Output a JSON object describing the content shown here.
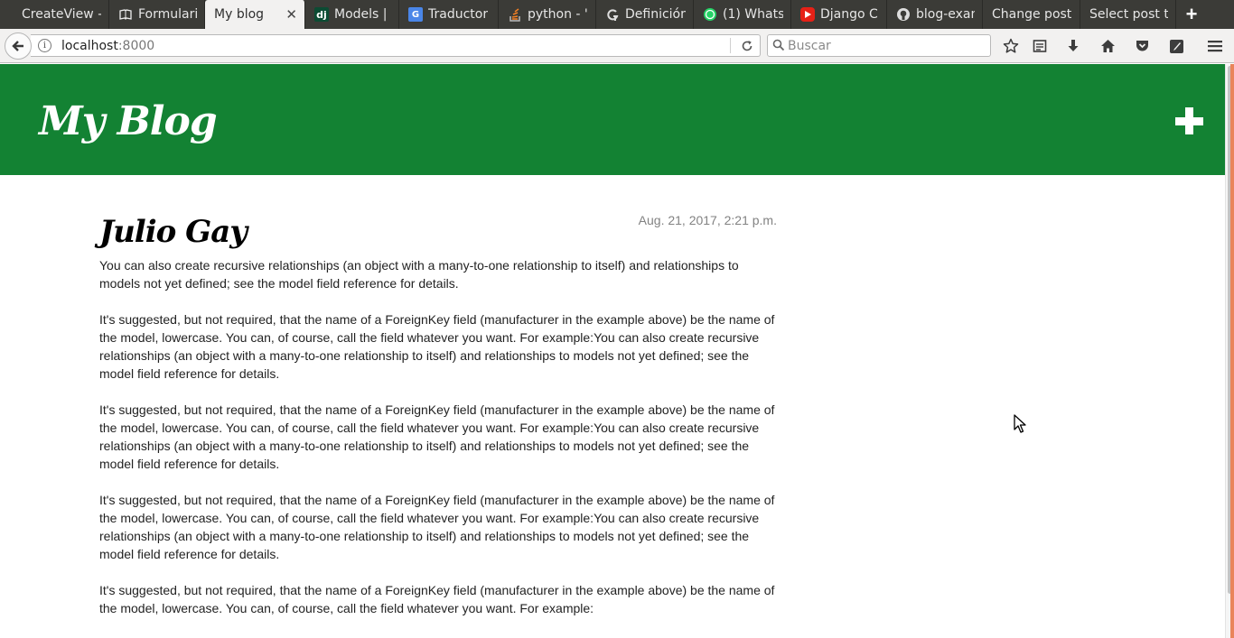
{
  "browser": {
    "tabs": [
      {
        "label": "CreateView -",
        "icon": "none",
        "active": false
      },
      {
        "label": "Formulari",
        "icon": "book-icon",
        "active": false
      },
      {
        "label": "My blog",
        "icon": "none",
        "active": true
      },
      {
        "label": "Models | D",
        "icon": "django-icon",
        "active": false
      },
      {
        "label": "Traductor",
        "icon": "google-translate-icon",
        "active": false
      },
      {
        "label": "python - '",
        "icon": "stackoverflow-icon",
        "active": false
      },
      {
        "label": "Definición",
        "icon": "github-gist-icon",
        "active": false
      },
      {
        "label": "(1) Whats",
        "icon": "whatsapp-icon",
        "active": false
      },
      {
        "label": "Django Cl",
        "icon": "youtube-icon",
        "active": false
      },
      {
        "label": "blog-exam",
        "icon": "github-icon",
        "active": false
      },
      {
        "label": "Change post",
        "icon": "none",
        "active": false
      },
      {
        "label": "Select post to",
        "icon": "none",
        "active": false
      }
    ],
    "new_tab_label": "+",
    "url": {
      "host": "localhost",
      "port": ":8000"
    },
    "search_placeholder": "Buscar"
  },
  "blog": {
    "title": "My Blog",
    "post": {
      "title": "Julio Gay",
      "date": "Aug. 21, 2017, 2:21 p.m.",
      "body": "You can also create recursive relationships (an object with a many-to-one relationship to itself) and relationships to models not yet defined; see the model field reference for details.\n\nIt's suggested, but not required, that the name of a ForeignKey field (manufacturer in the example above) be the name of the model, lowercase. You can, of course, call the field whatever you want. For example:You can also create recursive relationships (an object with a many-to-one relationship to itself) and relationships to models not yet defined; see the model field reference for details.\n\nIt's suggested, but not required, that the name of a ForeignKey field (manufacturer in the example above) be the name of the model, lowercase. You can, of course, call the field whatever you want. For example:You can also create recursive relationships (an object with a many-to-one relationship to itself) and relationships to models not yet defined; see the model field reference for details.\n\nIt's suggested, but not required, that the name of a ForeignKey field (manufacturer in the example above) be the name of the model, lowercase. You can, of course, call the field whatever you want. For example:You can also create recursive relationships (an object with a many-to-one relationship to itself) and relationships to models not yet defined; see the model field reference for details.\n\nIt's suggested, but not required, that the name of a ForeignKey field (manufacturer in the example above) be the name of the model, lowercase. You can, of course, call the field whatever you want. For example:"
    }
  },
  "colors": {
    "header_green": "#138233",
    "tabstrip": "#3b3b37",
    "toolbar": "#f2f1f0"
  }
}
